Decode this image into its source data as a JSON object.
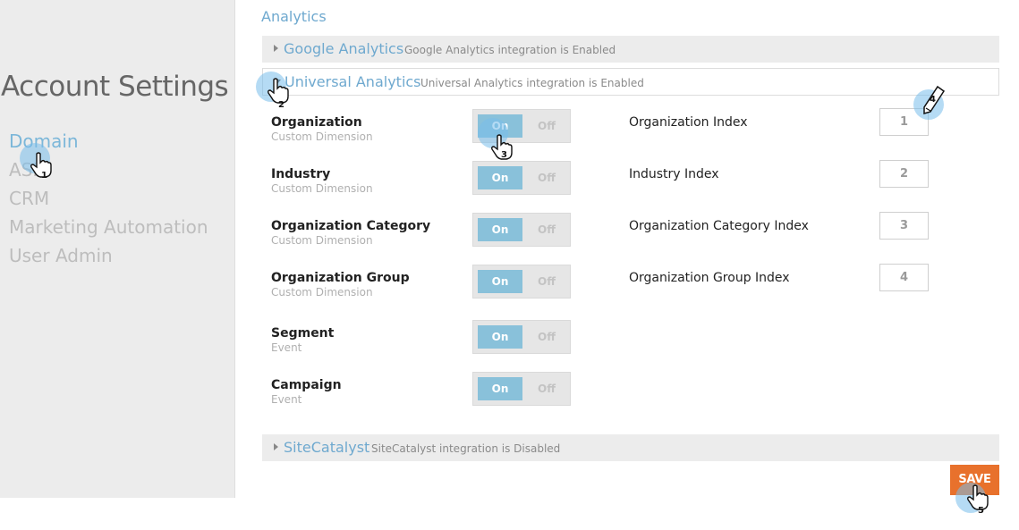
{
  "sidebar": {
    "title": "Account Settings",
    "items": [
      {
        "label": "Domain"
      },
      {
        "label": "ASM"
      },
      {
        "label": "CRM"
      },
      {
        "label": "Marketing Automation"
      },
      {
        "label": "User Admin"
      }
    ]
  },
  "analytics": {
    "section_label": "Analytics",
    "integrations": [
      {
        "name": "Google Analytics",
        "status": "Google Analytics integration is Enabled",
        "expanded": false
      },
      {
        "name": "Universal Analytics",
        "status": "Universal Analytics integration is Enabled",
        "expanded": true
      },
      {
        "name": "SiteCatalyst",
        "status": "SiteCatalyst integration is Disabled",
        "expanded": false
      }
    ],
    "rows": [
      {
        "label": "Organization",
        "type": "Custom Dimension",
        "on_label": "On",
        "off_label": "Off",
        "index_label": "Organization Index",
        "index_value": "1"
      },
      {
        "label": "Industry",
        "type": "Custom Dimension",
        "on_label": "On",
        "off_label": "Off",
        "index_label": "Industry Index",
        "index_value": "2"
      },
      {
        "label": "Organization Category",
        "type": "Custom Dimension",
        "on_label": "On",
        "off_label": "Off",
        "index_label": "Organization Category Index",
        "index_value": "3"
      },
      {
        "label": "Organization Group",
        "type": "Custom Dimension",
        "on_label": "On",
        "off_label": "Off",
        "index_label": "Organization Group Index",
        "index_value": "4"
      },
      {
        "label": "Segment",
        "type": "Event",
        "on_label": "On",
        "off_label": "Off"
      },
      {
        "label": "Campaign",
        "type": "Event",
        "on_label": "On",
        "off_label": "Off"
      }
    ]
  },
  "save_label": "SAVE",
  "hints": [
    "1",
    "2",
    "3",
    "4",
    "5"
  ],
  "colors": {
    "link_blue": "#6fa9cf",
    "toggle_on": "#89c1da",
    "save_orange": "#e8712c",
    "hint_circle": "#78beeb"
  }
}
